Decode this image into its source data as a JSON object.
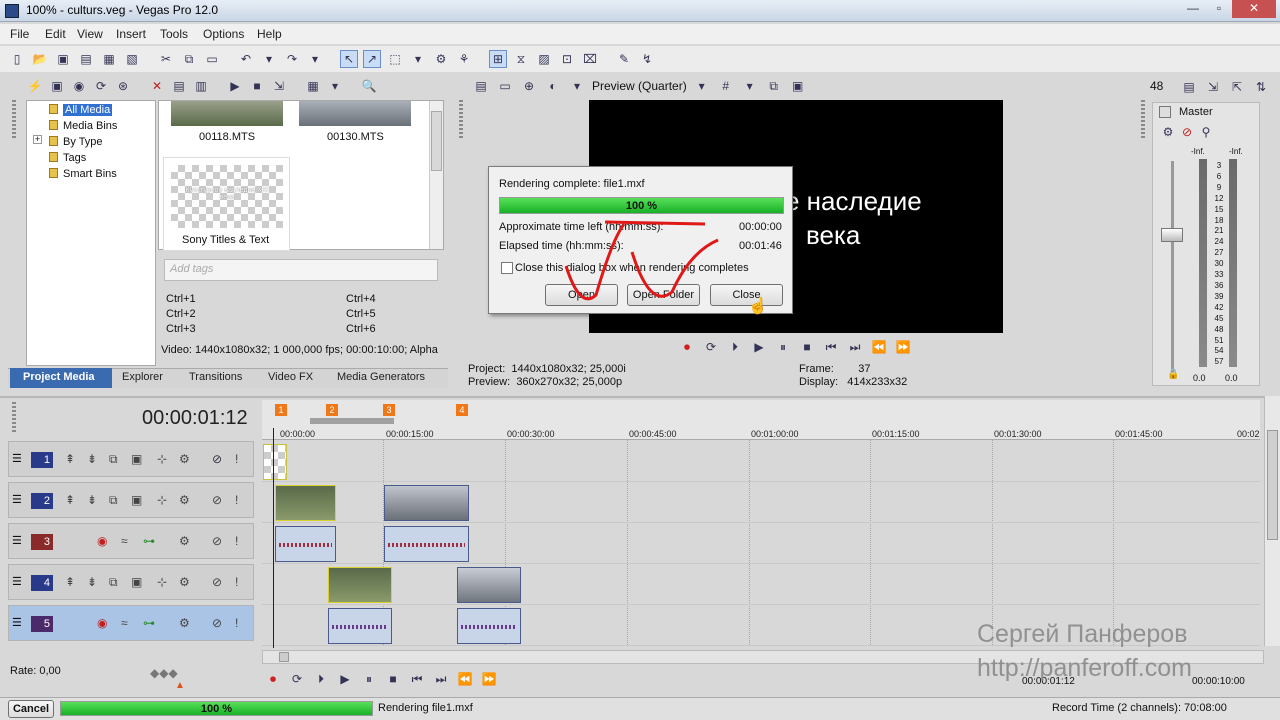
{
  "window": {
    "title": "100% - culturs.veg - Vegas Pro 12.0"
  },
  "menu": [
    "File",
    "Edit",
    "View",
    "Insert",
    "Tools",
    "Options",
    "Help"
  ],
  "project_media": {
    "tree": [
      "All Media",
      "Media Bins",
      "By Type",
      "Tags",
      "Smart Bins"
    ],
    "tree_expand": "+",
    "thumbs": [
      "00118.MTS",
      "00130.MTS"
    ],
    "selected_thumb_label": "Sony Titles & Text",
    "selected_thumb_text": "Культурное наследие XXI века",
    "tags_placeholder": "Add tags",
    "shortcuts": [
      "Ctrl+1",
      "Ctrl+4",
      "Ctrl+2",
      "Ctrl+5",
      "Ctrl+3",
      "Ctrl+6"
    ],
    "info": "Video: 1440x1080x32; 1 000,000 fps; 00:00:10:00; Alpha"
  },
  "tabs": [
    "Project Media",
    "Explorer",
    "Transitions",
    "Video FX",
    "Media Generators"
  ],
  "preview": {
    "quality": "Preview (Quarter)",
    "frame_text_1": "е наследие",
    "frame_text_2": "века",
    "project_label": "Project:",
    "project_value": "1440x1080x32; 25,000i",
    "preview_label": "Preview:",
    "preview_value": "360x270x32; 25,000p",
    "frame_label": "Frame:",
    "frame_value": "37",
    "display_label": "Display:",
    "display_value": "414x233x32"
  },
  "dialog": {
    "title": "Rendering complete: file1.mxf",
    "progress_label": "100 %",
    "progress": 1.0,
    "approx_label": "Approximate time left (hh:mm:ss):",
    "approx_value": "00:00:00",
    "elapsed_label": "Elapsed time (hh:mm:ss):",
    "elapsed_value": "00:01:46",
    "checkbox_label": "Close this dialog box when rendering completes",
    "buttons": [
      "Open",
      "Open Folder",
      "Close"
    ]
  },
  "mixer": {
    "level": "48",
    "master": "Master",
    "inf_left": "-Inf.",
    "inf_right": "-Inf.",
    "scale": [
      "3",
      "6",
      "9",
      "12",
      "15",
      "18",
      "21",
      "24",
      "27",
      "30",
      "33",
      "36",
      "39",
      "42",
      "45",
      "48",
      "51",
      "54",
      "57"
    ],
    "bottom_left": "0.0",
    "bottom_right": "0.0"
  },
  "timeline": {
    "timecode": "00:00:01:12",
    "markers": [
      "1",
      "2",
      "3",
      "4"
    ],
    "ruler": [
      "00:00:00",
      "00:00:15:00",
      "00:00:30:00",
      "00:00:45:00",
      "00:01:00:00",
      "00:01:15:00",
      "00:01:30:00",
      "00:01:45:00",
      "00:02"
    ],
    "tracks": [
      "1",
      "2",
      "3",
      "4",
      "5"
    ],
    "rate": "Rate: 0,00",
    "end_time": "00:00:10:00",
    "cursor_time": "00:00:01:12"
  },
  "status": {
    "cancel": "Cancel",
    "progress_label": "100 %",
    "progress": 1.0,
    "message": "Rendering file1.mxf",
    "record_time": "Record Time (2 channels): 70:08:00"
  },
  "watermark": {
    "name": "Сергей Панферов",
    "url": "http://panferoff.com"
  },
  "colors": {
    "progress": "#22c832",
    "accent": "#6a8fc6",
    "video_track": "#2a3a8a",
    "audio_track": "#8a2a2a"
  }
}
